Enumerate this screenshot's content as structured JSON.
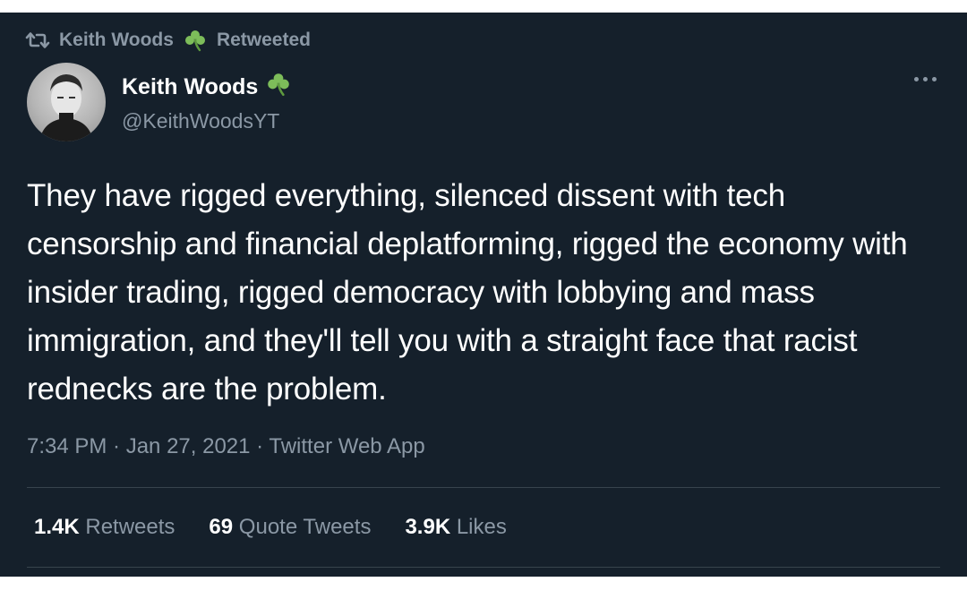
{
  "retweet_banner": {
    "name": "Keith Woods",
    "label": "Retweeted",
    "icon": "retweet-icon"
  },
  "author": {
    "display_name": "Keith Woods",
    "handle": "@KeithWoodsYT",
    "badge_icon": "shamrock-icon",
    "badge_color": "#7dbd5a"
  },
  "tweet": {
    "text": "They have rigged everything, silenced dissent with tech censorship and financial deplatforming, rigged the economy with insider trading, rigged democracy with lobbying and mass immigration, and they'll tell you with a straight face that racist rednecks are the problem.",
    "meta": "7:34 PM · Jan 27, 2021 · Twitter Web App"
  },
  "stats": {
    "retweets_count": "1.4K",
    "retweets_label": "Retweets",
    "quotes_count": "69",
    "quotes_label": "Quote Tweets",
    "likes_count": "3.9K",
    "likes_label": "Likes"
  },
  "colors": {
    "background": "#15202b",
    "secondary_text": "#8b98a5",
    "divider": "#38444d"
  }
}
